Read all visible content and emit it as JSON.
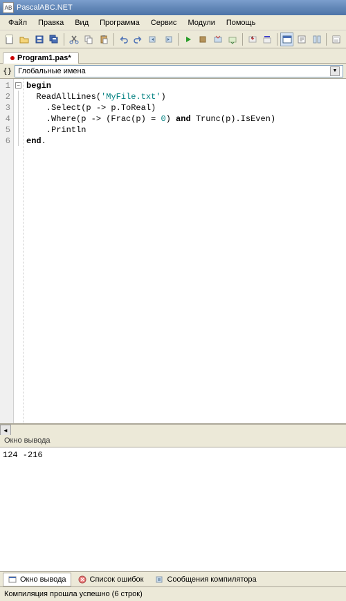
{
  "title": "PascalABC.NET",
  "menu": {
    "file": "Файл",
    "edit": "Правка",
    "view": "Вид",
    "program": "Программа",
    "service": "Сервис",
    "modules": "Модули",
    "help": "Помощь"
  },
  "tab": {
    "name": "Program1.pas*",
    "modified": true
  },
  "scope": {
    "icon": "{}",
    "label": "Глобальные имена"
  },
  "gutter": [
    "1",
    "2",
    "3",
    "4",
    "5",
    "6"
  ],
  "code": {
    "lines": [
      {
        "indent": "",
        "tokens": [
          {
            "t": "begin",
            "c": "kw"
          }
        ]
      },
      {
        "indent": "  ",
        "tokens": [
          {
            "t": "ReadAllLines(",
            "c": ""
          },
          {
            "t": "'MyFile.txt'",
            "c": "str"
          },
          {
            "t": ")",
            "c": ""
          }
        ]
      },
      {
        "indent": "    ",
        "tokens": [
          {
            "t": ".Select(p -> p.ToReal)",
            "c": ""
          }
        ]
      },
      {
        "indent": "    ",
        "tokens": [
          {
            "t": ".Where(p -> (Frac(p) = ",
            "c": ""
          },
          {
            "t": "0",
            "c": "num"
          },
          {
            "t": ") ",
            "c": ""
          },
          {
            "t": "and",
            "c": "kw"
          },
          {
            "t": " Trunc(p).IsEven)",
            "c": ""
          }
        ]
      },
      {
        "indent": "    ",
        "tokens": [
          {
            "t": ".Println",
            "c": ""
          }
        ]
      },
      {
        "indent": "",
        "tokens": [
          {
            "t": "end",
            "c": "kw"
          },
          {
            "t": ".",
            "c": ""
          }
        ]
      }
    ]
  },
  "output": {
    "title": "Окно вывода",
    "text": "124 -216"
  },
  "bottom_tabs": {
    "output": "Окно вывода",
    "errors": "Список ошибок",
    "compiler": "Сообщения компилятора"
  },
  "status": "Компиляция прошла успешно (6 строк)",
  "colors": {
    "title_grad_top": "#7b9ecd",
    "title_grad_bot": "#4d74a8",
    "bg": "#ece9d8"
  }
}
